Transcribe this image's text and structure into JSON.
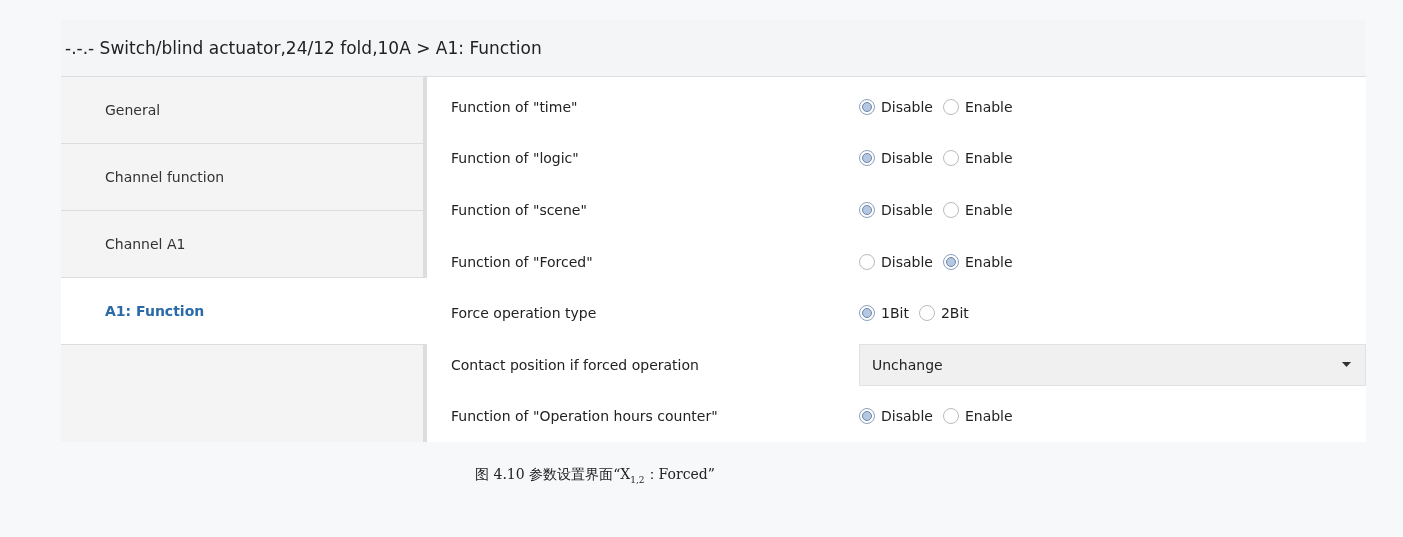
{
  "header": {
    "title": "-.-.- Switch/blind actuator,24/12 fold,10A > A1: Function"
  },
  "sidebar": {
    "items": [
      {
        "label": "General",
        "selected": false
      },
      {
        "label": "Channel function",
        "selected": false
      },
      {
        "label": "Channel A1",
        "selected": false
      },
      {
        "label": "A1: Function",
        "selected": true
      }
    ]
  },
  "parameters": [
    {
      "kind": "radio",
      "label": "Function of \"time\"",
      "options": [
        {
          "label": "Disable",
          "selected": true
        },
        {
          "label": "Enable",
          "selected": false
        }
      ]
    },
    {
      "kind": "radio",
      "label": "Function of \"logic\"",
      "options": [
        {
          "label": "Disable",
          "selected": true
        },
        {
          "label": "Enable",
          "selected": false
        }
      ]
    },
    {
      "kind": "radio",
      "label": "Function of \"scene\"",
      "options": [
        {
          "label": "Disable",
          "selected": true
        },
        {
          "label": "Enable",
          "selected": false
        }
      ]
    },
    {
      "kind": "radio",
      "label": "Function of \"Forced\"",
      "options": [
        {
          "label": "Disable",
          "selected": false
        },
        {
          "label": "Enable",
          "selected": true
        }
      ]
    },
    {
      "kind": "radio",
      "label": "Force operation type",
      "options": [
        {
          "label": "1Bit",
          "selected": true
        },
        {
          "label": "2Bit",
          "selected": false
        }
      ]
    },
    {
      "kind": "dropdown",
      "label": "Contact position if forced operation",
      "value": "Unchange"
    },
    {
      "kind": "radio",
      "label": "Function of \"Operation hours counter\"",
      "options": [
        {
          "label": "Disable",
          "selected": true
        },
        {
          "label": "Enable",
          "selected": false
        }
      ]
    }
  ],
  "caption": "图 4.10 参数设置界面“X$_{1,2}$：Forced”"
}
